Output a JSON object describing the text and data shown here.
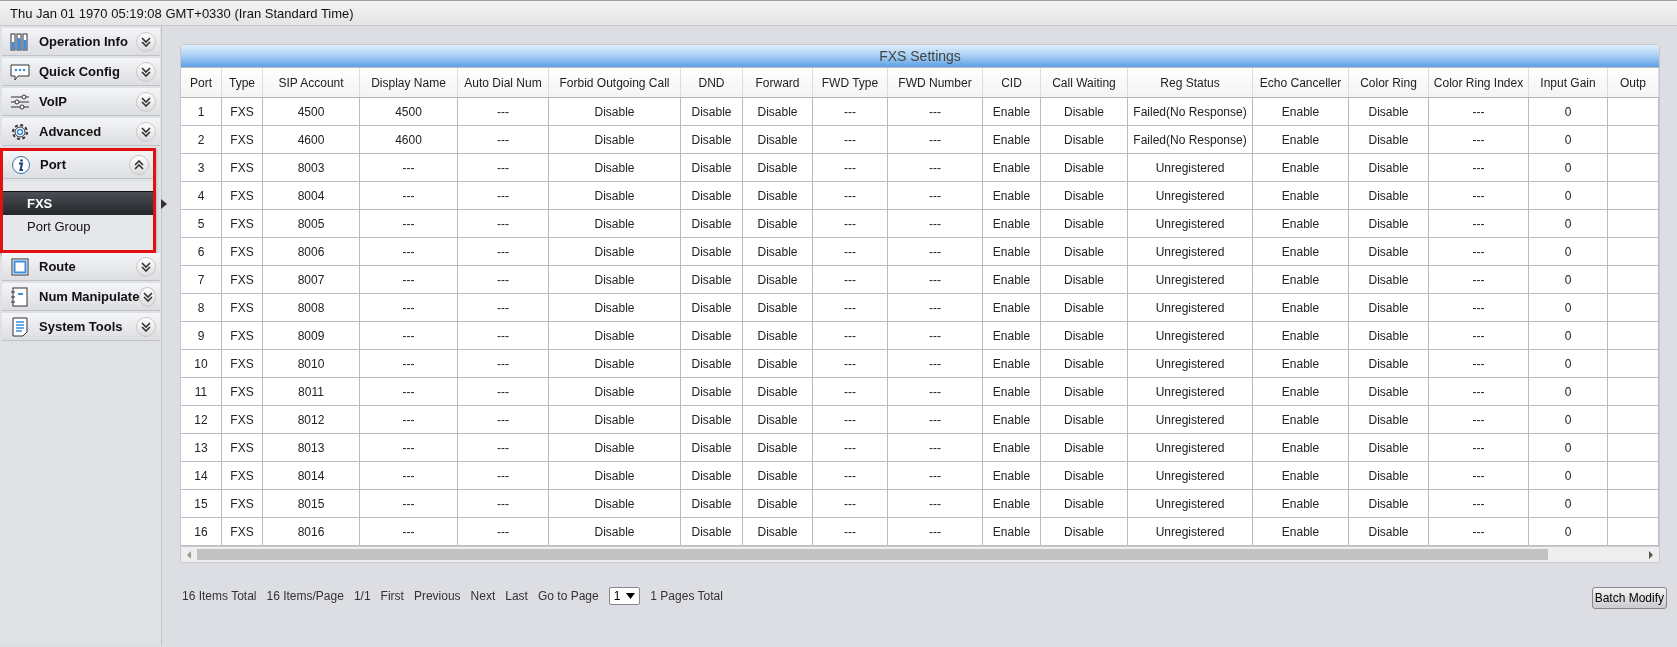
{
  "top_bar": {
    "datetime": "Thu Jan 01 1970 05:19:08 GMT+0330 (Iran Standard Time)"
  },
  "sidebar": {
    "items": [
      {
        "label": "Operation Info",
        "expanded": false,
        "highlighted": false
      },
      {
        "label": "Quick Config",
        "expanded": false,
        "highlighted": false
      },
      {
        "label": "VoIP",
        "expanded": false,
        "highlighted": false
      },
      {
        "label": "Advanced",
        "expanded": false,
        "highlighted": false
      },
      {
        "label": "Port",
        "expanded": true,
        "highlighted": true,
        "children": [
          {
            "label": "FXS",
            "selected": true
          },
          {
            "label": "Port Group",
            "selected": false
          }
        ]
      },
      {
        "label": "Route",
        "expanded": false,
        "highlighted": false
      },
      {
        "label": "Num Manipulate",
        "expanded": false,
        "highlighted": false
      },
      {
        "label": "System Tools",
        "expanded": false,
        "highlighted": false
      }
    ]
  },
  "panel": {
    "title": "FXS Settings"
  },
  "table": {
    "columns": [
      "Port",
      "Type",
      "SIP Account",
      "Display Name",
      "Auto Dial Num",
      "Forbid Outgoing Call",
      "DND",
      "Forward",
      "FWD Type",
      "FWD Number",
      "CID",
      "Call Waiting",
      "Reg Status",
      "Echo Canceller",
      "Color Ring",
      "Color Ring Index",
      "Input Gain",
      "Outp"
    ],
    "rows": [
      [
        "1",
        "FXS",
        "4500",
        "4500",
        "---",
        "Disable",
        "Disable",
        "Disable",
        "---",
        "---",
        "Enable",
        "Disable",
        "Failed(No Response)",
        "Enable",
        "Disable",
        "---",
        "0"
      ],
      [
        "2",
        "FXS",
        "4600",
        "4600",
        "---",
        "Disable",
        "Disable",
        "Disable",
        "---",
        "---",
        "Enable",
        "Disable",
        "Failed(No Response)",
        "Enable",
        "Disable",
        "---",
        "0"
      ],
      [
        "3",
        "FXS",
        "8003",
        "---",
        "---",
        "Disable",
        "Disable",
        "Disable",
        "---",
        "---",
        "Enable",
        "Disable",
        "Unregistered",
        "Enable",
        "Disable",
        "---",
        "0"
      ],
      [
        "4",
        "FXS",
        "8004",
        "---",
        "---",
        "Disable",
        "Disable",
        "Disable",
        "---",
        "---",
        "Enable",
        "Disable",
        "Unregistered",
        "Enable",
        "Disable",
        "---",
        "0"
      ],
      [
        "5",
        "FXS",
        "8005",
        "---",
        "---",
        "Disable",
        "Disable",
        "Disable",
        "---",
        "---",
        "Enable",
        "Disable",
        "Unregistered",
        "Enable",
        "Disable",
        "---",
        "0"
      ],
      [
        "6",
        "FXS",
        "8006",
        "---",
        "---",
        "Disable",
        "Disable",
        "Disable",
        "---",
        "---",
        "Enable",
        "Disable",
        "Unregistered",
        "Enable",
        "Disable",
        "---",
        "0"
      ],
      [
        "7",
        "FXS",
        "8007",
        "---",
        "---",
        "Disable",
        "Disable",
        "Disable",
        "---",
        "---",
        "Enable",
        "Disable",
        "Unregistered",
        "Enable",
        "Disable",
        "---",
        "0"
      ],
      [
        "8",
        "FXS",
        "8008",
        "---",
        "---",
        "Disable",
        "Disable",
        "Disable",
        "---",
        "---",
        "Enable",
        "Disable",
        "Unregistered",
        "Enable",
        "Disable",
        "---",
        "0"
      ],
      [
        "9",
        "FXS",
        "8009",
        "---",
        "---",
        "Disable",
        "Disable",
        "Disable",
        "---",
        "---",
        "Enable",
        "Disable",
        "Unregistered",
        "Enable",
        "Disable",
        "---",
        "0"
      ],
      [
        "10",
        "FXS",
        "8010",
        "---",
        "---",
        "Disable",
        "Disable",
        "Disable",
        "---",
        "---",
        "Enable",
        "Disable",
        "Unregistered",
        "Enable",
        "Disable",
        "---",
        "0"
      ],
      [
        "11",
        "FXS",
        "8011",
        "---",
        "---",
        "Disable",
        "Disable",
        "Disable",
        "---",
        "---",
        "Enable",
        "Disable",
        "Unregistered",
        "Enable",
        "Disable",
        "---",
        "0"
      ],
      [
        "12",
        "FXS",
        "8012",
        "---",
        "---",
        "Disable",
        "Disable",
        "Disable",
        "---",
        "---",
        "Enable",
        "Disable",
        "Unregistered",
        "Enable",
        "Disable",
        "---",
        "0"
      ],
      [
        "13",
        "FXS",
        "8013",
        "---",
        "---",
        "Disable",
        "Disable",
        "Disable",
        "---",
        "---",
        "Enable",
        "Disable",
        "Unregistered",
        "Enable",
        "Disable",
        "---",
        "0"
      ],
      [
        "14",
        "FXS",
        "8014",
        "---",
        "---",
        "Disable",
        "Disable",
        "Disable",
        "---",
        "---",
        "Enable",
        "Disable",
        "Unregistered",
        "Enable",
        "Disable",
        "---",
        "0"
      ],
      [
        "15",
        "FXS",
        "8015",
        "---",
        "---",
        "Disable",
        "Disable",
        "Disable",
        "---",
        "---",
        "Enable",
        "Disable",
        "Unregistered",
        "Enable",
        "Disable",
        "---",
        "0"
      ],
      [
        "16",
        "FXS",
        "8016",
        "---",
        "---",
        "Disable",
        "Disable",
        "Disable",
        "---",
        "---",
        "Enable",
        "Disable",
        "Unregistered",
        "Enable",
        "Disable",
        "---",
        "0"
      ]
    ]
  },
  "pagination": {
    "total": "16 Items Total",
    "per_page": "16 Items/Page",
    "page_of": "1/1",
    "first": "First",
    "previous": "Previous",
    "next": "Next",
    "last": "Last",
    "goto_label": "Go to Page",
    "page_select": "1",
    "pages_total": "1 Pages Total"
  },
  "buttons": {
    "batch_modify": "Batch Modify"
  }
}
